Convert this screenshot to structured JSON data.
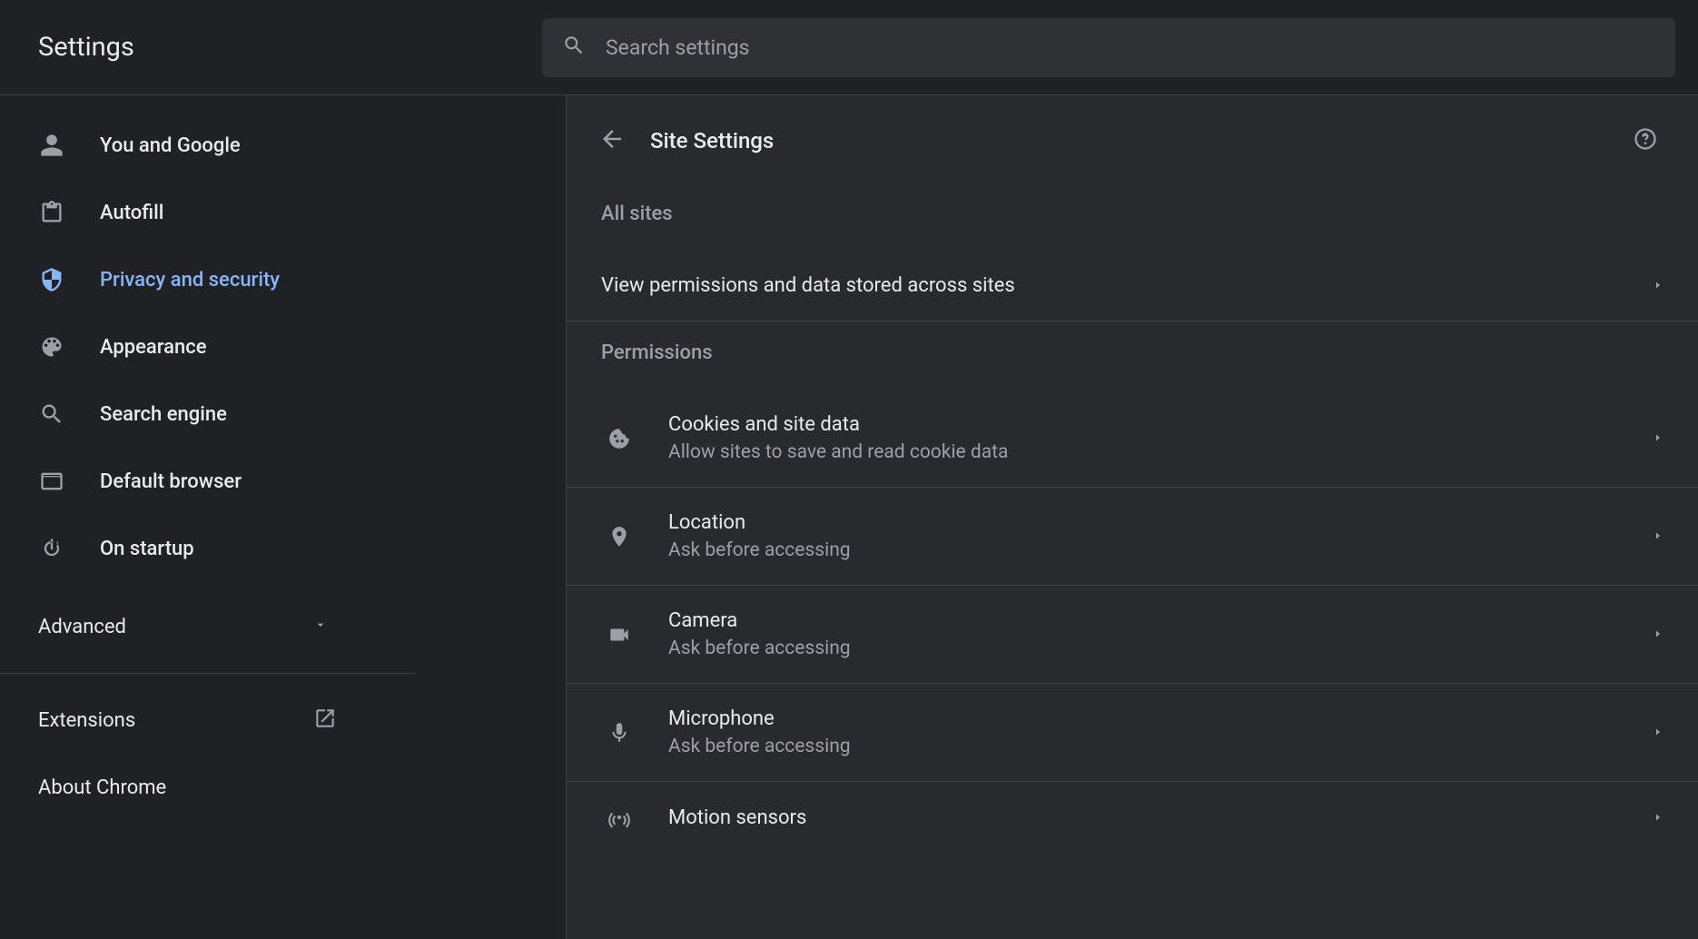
{
  "header": {
    "title": "Settings",
    "search_placeholder": "Search settings"
  },
  "sidebar": {
    "items": [
      {
        "label": "You and Google"
      },
      {
        "label": "Autofill"
      },
      {
        "label": "Privacy and security"
      },
      {
        "label": "Appearance"
      },
      {
        "label": "Search engine"
      },
      {
        "label": "Default browser"
      },
      {
        "label": "On startup"
      }
    ],
    "advanced_label": "Advanced",
    "extensions_label": "Extensions",
    "about_label": "About Chrome"
  },
  "main": {
    "page_title": "Site Settings",
    "section_all_sites": "All sites",
    "all_sites_row": "View permissions and data stored across sites",
    "section_permissions": "Permissions",
    "permissions": [
      {
        "title": "Cookies and site data",
        "sub": "Allow sites to save and read cookie data"
      },
      {
        "title": "Location",
        "sub": "Ask before accessing"
      },
      {
        "title": "Camera",
        "sub": "Ask before accessing"
      },
      {
        "title": "Microphone",
        "sub": "Ask before accessing"
      },
      {
        "title": "Motion sensors",
        "sub": ""
      }
    ]
  }
}
